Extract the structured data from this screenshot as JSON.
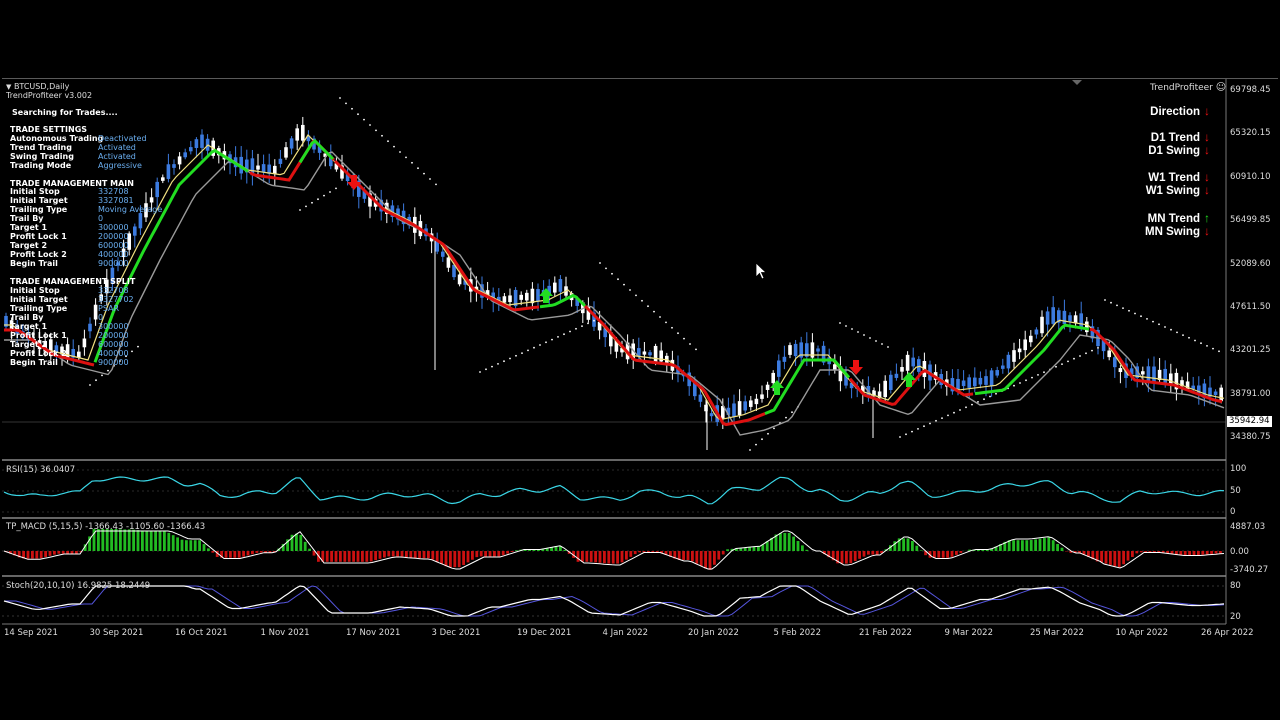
{
  "chart_window": {
    "symbol": "BTCUSD,Daily",
    "ea_name": "TrendProfiteer v3.002",
    "status": "Searching for Trades....",
    "brand": "TrendProfiteer"
  },
  "trade_settings": {
    "title": "TRADE SETTINGS",
    "rows": [
      {
        "k": "Autonomous Trading",
        "v": "Deactivated"
      },
      {
        "k": "Trend Trading",
        "v": "Activated"
      },
      {
        "k": "Swing Trading",
        "v": "Activated"
      },
      {
        "k": "Trading Mode",
        "v": "Aggressive"
      }
    ]
  },
  "trade_mgmt_main": {
    "title": "TRADE MANAGEMENT MAIN",
    "rows": [
      {
        "k": "Initial Stop",
        "v": "332708"
      },
      {
        "k": "Initial Target",
        "v": "3327081"
      },
      {
        "k": "Trailing Type",
        "v": "Moving Average"
      },
      {
        "k": "Trail By",
        "v": "0"
      },
      {
        "k": "Target 1",
        "v": "300000"
      },
      {
        "k": "Profit Lock 1",
        "v": "200000"
      },
      {
        "k": "Target 2",
        "v": "600000"
      },
      {
        "k": "Profit Lock 2",
        "v": "400000"
      },
      {
        "k": "Begin Trail",
        "v": "900000"
      }
    ]
  },
  "trade_mgmt_split": {
    "title": "TRADE MANAGEMENT SPLIT",
    "rows": [
      {
        "k": "Initial Stop",
        "v": "332708"
      },
      {
        "k": "Initial Target",
        "v": "3327702"
      },
      {
        "k": "Trailing Type",
        "v": "PSAR"
      },
      {
        "k": "Trail By",
        "v": "0"
      },
      {
        "k": "Target 1",
        "v": "300000"
      },
      {
        "k": "Profit Lock 1",
        "v": "200000"
      },
      {
        "k": "Target 2",
        "v": "600000"
      },
      {
        "k": "Profit Lock 2",
        "v": "400000"
      },
      {
        "k": "Begin Trail",
        "v": "900000"
      }
    ]
  },
  "dashboard": {
    "rows": [
      {
        "label": "Direction",
        "dir": "down"
      },
      {
        "label": "D1 Trend",
        "dir": "down"
      },
      {
        "label": "D1 Swing",
        "dir": "down"
      },
      {
        "label": "W1 Trend",
        "dir": "down"
      },
      {
        "label": "W1 Swing",
        "dir": "down"
      },
      {
        "label": "MN Trend",
        "dir": "up"
      },
      {
        "label": "MN Swing",
        "dir": "down"
      }
    ]
  },
  "price_axis": [
    "69798.45",
    "65320.15",
    "60910.10",
    "56499.85",
    "52089.60",
    "47611.50",
    "43201.25",
    "38791.00",
    "34380.75"
  ],
  "current_price": "35942.94",
  "indicators": {
    "rsi": {
      "title": "RSI(15) 36.0407",
      "levels": [
        "100",
        "50",
        "0"
      ]
    },
    "macd": {
      "title": "TP_MACD (5,15,5) -1366.43 -1105.60 -1366.43",
      "levels": [
        "4887.03",
        "0.00",
        "-3740.27"
      ]
    },
    "stoch": {
      "title": "Stoch(20,10,10) 16.9825 18.2449",
      "levels": [
        "80",
        "20"
      ]
    }
  },
  "date_axis": [
    "14 Sep 2021",
    "30 Sep 2021",
    "16 Oct 2021",
    "1 Nov 2021",
    "17 Nov 2021",
    "3 Dec 2021",
    "19 Dec 2021",
    "4 Jan 2022",
    "20 Jan 2022",
    "5 Feb 2022",
    "21 Feb 2022",
    "9 Mar 2022",
    "25 Mar 2022",
    "10 Apr 2022",
    "26 Apr 2022"
  ],
  "colors": {
    "bull": "#3c7be0",
    "bear": "#ffffff",
    "up_arrow": "#22dd22",
    "down_arrow": "#ee1111",
    "trend_up": "#22dd22",
    "trend_down": "#dd1111",
    "fast_ma": "#f0e080",
    "slow_ma": "#9a9a9a",
    "rsi": "#3ad6e6",
    "stoch_main": "#ffffff",
    "stoch_signal": "#5555dd"
  }
}
